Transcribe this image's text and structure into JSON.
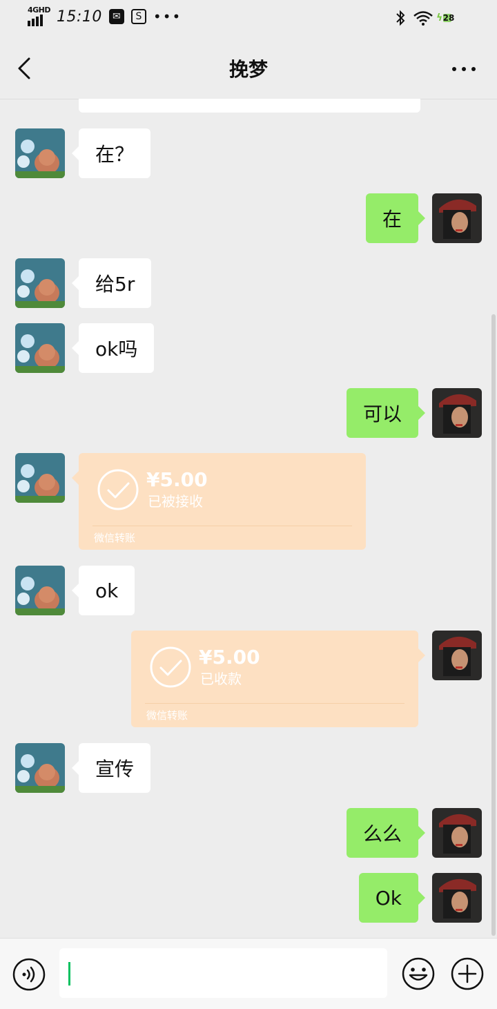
{
  "status_bar": {
    "network": "4GHD",
    "time": "15:10",
    "battery": "28"
  },
  "header": {
    "title": "挽梦"
  },
  "messages": [
    {
      "from": "friend",
      "type": "text",
      "text": "在？"
    },
    {
      "from": "me",
      "type": "text",
      "text": "在"
    },
    {
      "from": "friend",
      "type": "text",
      "text": "给5r"
    },
    {
      "from": "friend",
      "type": "text",
      "text": "ok吗"
    },
    {
      "from": "me",
      "type": "text",
      "text": "可以"
    },
    {
      "from": "friend",
      "type": "transfer",
      "amount": "¥5.00",
      "status": "已被接收",
      "service": "微信转账"
    },
    {
      "from": "friend",
      "type": "text",
      "text": "ok"
    },
    {
      "from": "me",
      "type": "transfer",
      "amount": "¥5.00",
      "status": "已收款",
      "service": "微信转账"
    },
    {
      "from": "friend",
      "type": "text",
      "text": "宣传"
    },
    {
      "from": "me",
      "type": "text",
      "text": "么么"
    },
    {
      "from": "me",
      "type": "text",
      "text": "Ok"
    }
  ],
  "input_bar": {
    "value": ""
  },
  "colors": {
    "background": "#ededed",
    "my_bubble": "#95ec69",
    "friend_bubble": "#ffffff",
    "transfer_card": "#fde0c2",
    "accent": "#07c160"
  }
}
